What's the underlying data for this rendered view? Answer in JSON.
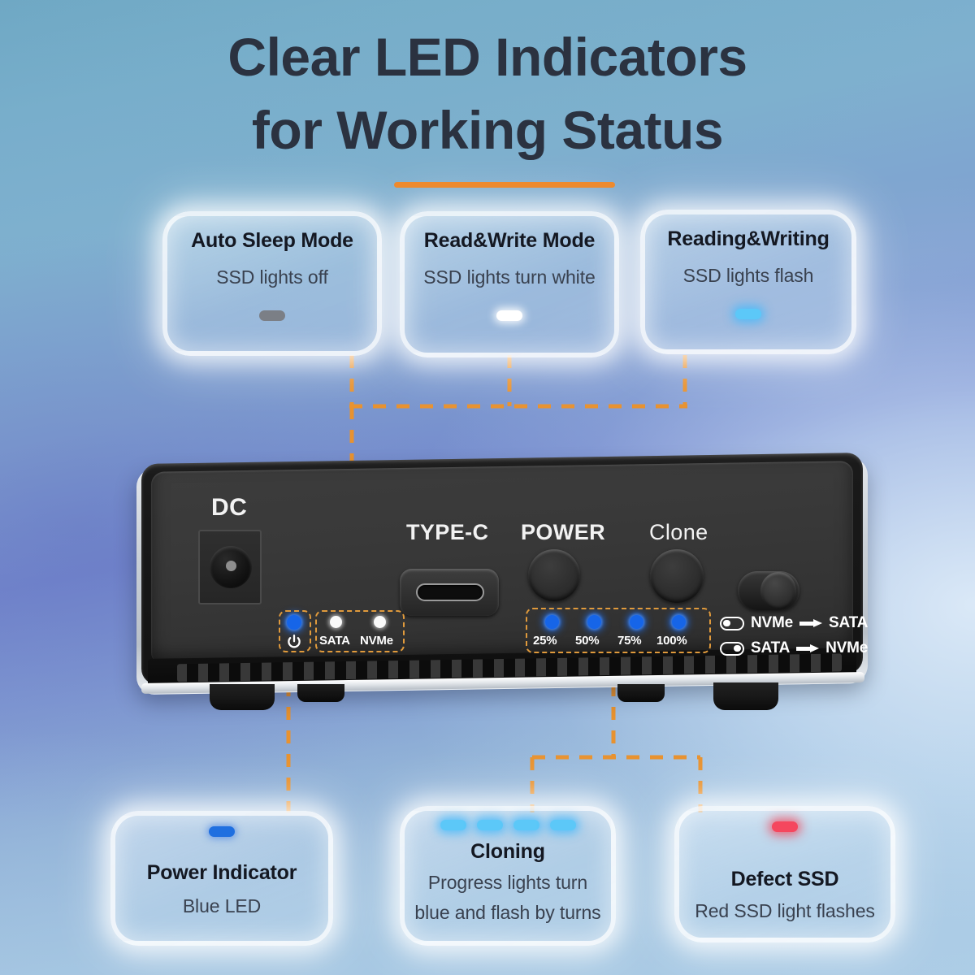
{
  "heading": {
    "line1": "Clear LED Indicators",
    "line2": "for Working Status",
    "accent_color": "#ed8a2e"
  },
  "cards": {
    "auto_sleep": {
      "title": "Auto Sleep Mode",
      "subtitle": "SSD lights off",
      "led": "grey-pill-icon"
    },
    "read_write": {
      "title": "Read&Write Mode",
      "subtitle": "SSD lights turn white",
      "led": "white-pill-icon"
    },
    "reading_writing": {
      "title": "Reading&Writing",
      "subtitle": "SSD lights flash",
      "led": "cyan-pill-icon"
    },
    "power_indicator": {
      "title": "Power Indicator",
      "subtitle": "Blue LED",
      "led": "blue-pill-icon"
    },
    "cloning": {
      "title": "Cloning",
      "subtitle_line1": "Progress lights turn",
      "subtitle_line2": "blue and flash by turns",
      "led_count": 4,
      "led": "cyan-pill-icon"
    },
    "defect_ssd": {
      "title": "Defect SSD",
      "subtitle": "Red SSD light flashes",
      "led": "red-pill-icon"
    }
  },
  "device": {
    "labels": {
      "dc": "DC",
      "typec": "TYPE-C",
      "power": "POWER",
      "clone": "Clone"
    },
    "status_leds": {
      "power_symbol": "power-icon",
      "sata": "SATA",
      "nvme": "NVMe"
    },
    "progress_leds": [
      {
        "label": "25%",
        "state": "on"
      },
      {
        "label": "50%",
        "state": "on"
      },
      {
        "label": "75%",
        "state": "on"
      },
      {
        "label": "100%",
        "state": "on"
      }
    ],
    "clone_direction": [
      {
        "toggle": "left",
        "from": "NVMe",
        "to": "SATA"
      },
      {
        "toggle": "right",
        "from": "SATA",
        "to": "NVMe"
      }
    ]
  },
  "colors": {
    "accent_orange": "#ed8a2e",
    "led_blue": "#1665e8",
    "led_cyan": "#5cc8f8",
    "led_red": "#f5475e",
    "heading_text": "#2b3240"
  }
}
